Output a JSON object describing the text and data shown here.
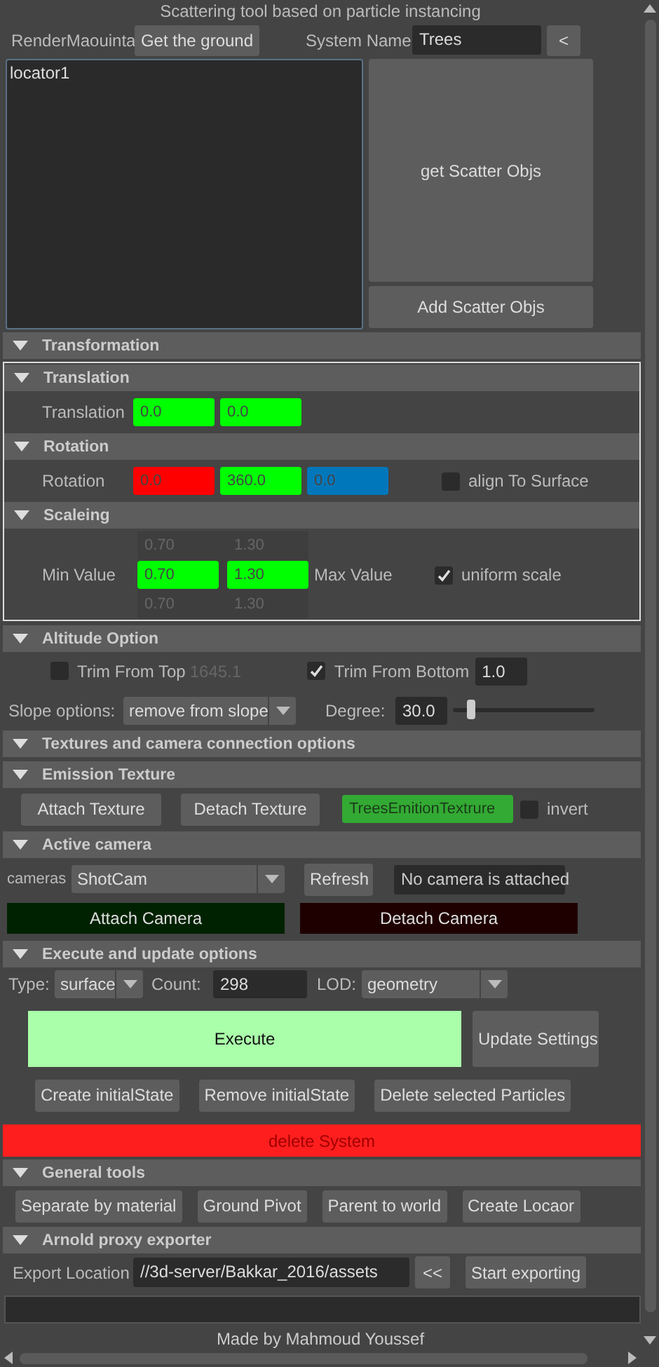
{
  "title": "Scattering tool based on particle instancing",
  "ground": {
    "label": "RenderMaouinta",
    "button": "Get the ground"
  },
  "system": {
    "label": "System Name",
    "value": "Trees",
    "button": "<"
  },
  "scatter_objects": {
    "items": [
      "locator1"
    ],
    "buttons": [
      "get Scatter Objs",
      "Add Scatter Objs"
    ]
  },
  "transformation": {
    "title": "Transformation",
    "expanded": true,
    "translation": {
      "title": "Translation",
      "expanded": true,
      "label": "Translation",
      "fields": [
        {
          "value": "0.0",
          "color": "#00ff00"
        },
        {
          "value": "0.0",
          "color": "#00ff00"
        }
      ]
    },
    "rotation": {
      "title": "Rotation",
      "expanded": true,
      "label": "Rotation",
      "fields": [
        {
          "value": "0.0",
          "color": "#ff0000"
        },
        {
          "value": "360.0",
          "color": "#00ff00"
        },
        {
          "value": "0.0",
          "color": "#0077bb"
        }
      ],
      "align_to_surface": {
        "label": "align To Surface",
        "checked": false
      }
    },
    "scaling": {
      "title": "Scaleing",
      "expanded": true,
      "min_label": "Min Value",
      "max_label": "Max Value",
      "fields": [
        {
          "above": "0.70",
          "value": "0.70",
          "below": "0.70",
          "color": "#00ff00"
        },
        {
          "above": "1.30",
          "value": "1.30",
          "below": "1.30",
          "color": "#00ff00"
        }
      ],
      "uniform_scale": {
        "label": "uniform scale",
        "checked": true
      }
    }
  },
  "altitude": {
    "title": "Altitude Option",
    "expanded": true,
    "trim_top": {
      "label": "Trim From Top",
      "checked": false,
      "value": "1645.1"
    },
    "trim_bottom": {
      "label": "Trim From Bottom",
      "checked": true,
      "value": "1.0"
    },
    "slope": {
      "label": "Slope options:",
      "option": "remove from slope"
    },
    "degree": {
      "label": "Degree:",
      "value": "30.0",
      "level": 0.1
    }
  },
  "textures": {
    "title": "Textures and camera connection options",
    "expanded": true,
    "emission": {
      "title": "Emission Texture",
      "expanded": true,
      "buttons": [
        "Attach Texture",
        "Detach Texture"
      ],
      "texture": "TreesEmitionTextrure",
      "invert": {
        "label": "invert",
        "checked": false
      }
    },
    "camera": {
      "title": "Active camera",
      "expanded": true,
      "label": "cameras",
      "option": "ShotCam",
      "refresh": "Refresh",
      "status": "No camera is attached",
      "attach": "Attach Camera",
      "detach": "Detach Camera"
    }
  },
  "execute": {
    "title": "Execute and update options",
    "expanded": true,
    "type": {
      "label": "Type:",
      "option": "surface"
    },
    "count": {
      "label": "Count:",
      "value": "298"
    },
    "lod": {
      "label": "LOD:",
      "option": "geometry"
    },
    "execute_button": "Execute",
    "update_button": "Update Settings",
    "state_buttons": [
      "Create initialState",
      "Remove initialState",
      "Delete selected Particles"
    ],
    "delete_button": "delete System"
  },
  "general_tools": {
    "title": "General tools",
    "expanded": true,
    "buttons": [
      "Separate by material",
      "Ground Pivot",
      "Parent to world",
      "Create Locaor"
    ]
  },
  "arnold": {
    "title": "Arnold proxy exporter",
    "expanded": true,
    "label": "Export Location",
    "value": "//3d-server/Bakkar_2016/assets",
    "browse": "<<",
    "start": "Start exporting"
  },
  "footer": "Made by Mahmoud Youssef"
}
